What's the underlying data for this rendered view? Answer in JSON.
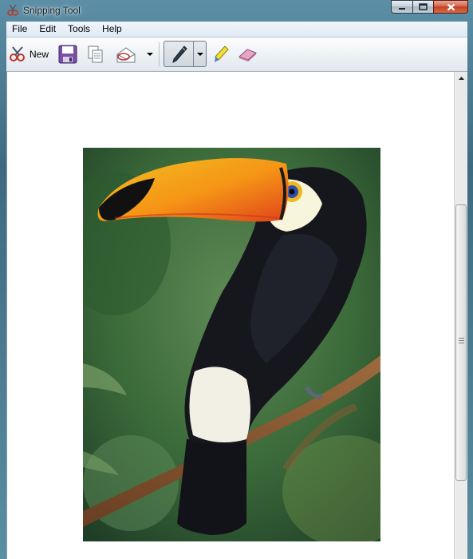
{
  "window": {
    "title": "Snipping Tool"
  },
  "caption_buttons": [
    "minimize-icon",
    "maximize-icon",
    "close-icon"
  ],
  "menu": [
    "File",
    "Edit",
    "Tools",
    "Help"
  ],
  "toolbar": {
    "new_label": "New",
    "buttons": [
      "new-snip-icon",
      "save-icon",
      "copy-icon",
      "send-snip-icon",
      "dropdown-arrow-icon",
      "pen-icon",
      "dropdown-arrow-icon",
      "highlighter-icon",
      "eraser-icon"
    ]
  },
  "content": {
    "image_subject": "toucan",
    "colors": {
      "background": "#ffffff",
      "bill": "#f7a21a",
      "bill_tip": "#111111",
      "body": "#15161b",
      "throat": "#f8f5dd",
      "foliage": "#3b6a3a",
      "branch": "#8a5a33"
    }
  }
}
